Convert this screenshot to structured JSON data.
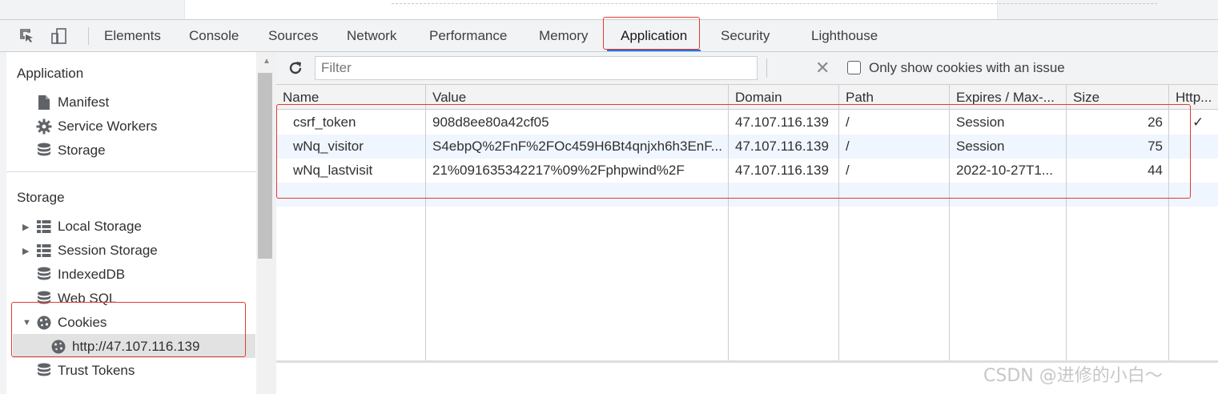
{
  "devtools": {
    "tabs": [
      {
        "label": "Elements"
      },
      {
        "label": "Console"
      },
      {
        "label": "Sources"
      },
      {
        "label": "Network"
      },
      {
        "label": "Performance"
      },
      {
        "label": "Memory"
      },
      {
        "label": "Application",
        "active": true
      },
      {
        "label": "Security"
      },
      {
        "label": "Lighthouse"
      }
    ]
  },
  "sidebar": {
    "application_section": {
      "title": "Application",
      "items": [
        {
          "label": "Manifest",
          "icon": "document-icon"
        },
        {
          "label": "Service Workers",
          "icon": "gear-icon"
        },
        {
          "label": "Storage",
          "icon": "database-icon"
        }
      ]
    },
    "storage_section": {
      "title": "Storage",
      "items": [
        {
          "label": "Local Storage",
          "icon": "grid-icon",
          "expandable": true
        },
        {
          "label": "Session Storage",
          "icon": "grid-icon",
          "expandable": true
        },
        {
          "label": "IndexedDB",
          "icon": "database-icon"
        },
        {
          "label": "Web SQL",
          "icon": "database-icon"
        },
        {
          "label": "Cookies",
          "icon": "cookie-icon",
          "expanded": true
        },
        {
          "label": "http://47.107.116.139",
          "icon": "cookie-icon",
          "selected": true
        },
        {
          "label": "Trust Tokens",
          "icon": "database-icon"
        }
      ]
    }
  },
  "cookies_toolbar": {
    "filter_placeholder": "Filter",
    "only_issues_label": "Only show cookies with an issue"
  },
  "cookies_table": {
    "columns": [
      "Name",
      "Value",
      "Domain",
      "Path",
      "Expires / Max-...",
      "Size",
      "Http..."
    ],
    "rows": [
      {
        "name": "csrf_token",
        "value": "908d8ee80a42cf05",
        "domain": "47.107.116.139",
        "path": "/",
        "expires": "Session",
        "size": "26",
        "http": "✓"
      },
      {
        "name": "wNq_visitor",
        "value": "S4ebpQ%2FnF%2FOc459H6Bt4qnjxh6h3EnF...",
        "domain": "47.107.116.139",
        "path": "/",
        "expires": "Session",
        "size": "75",
        "http": ""
      },
      {
        "name": "wNq_lastvisit",
        "value": "21%091635342217%09%2Fphpwind%2F",
        "domain": "47.107.116.139",
        "path": "/",
        "expires": "2022-10-27T1...",
        "size": "44",
        "http": ""
      }
    ]
  },
  "watermark": "CSDN @进修的小白～"
}
